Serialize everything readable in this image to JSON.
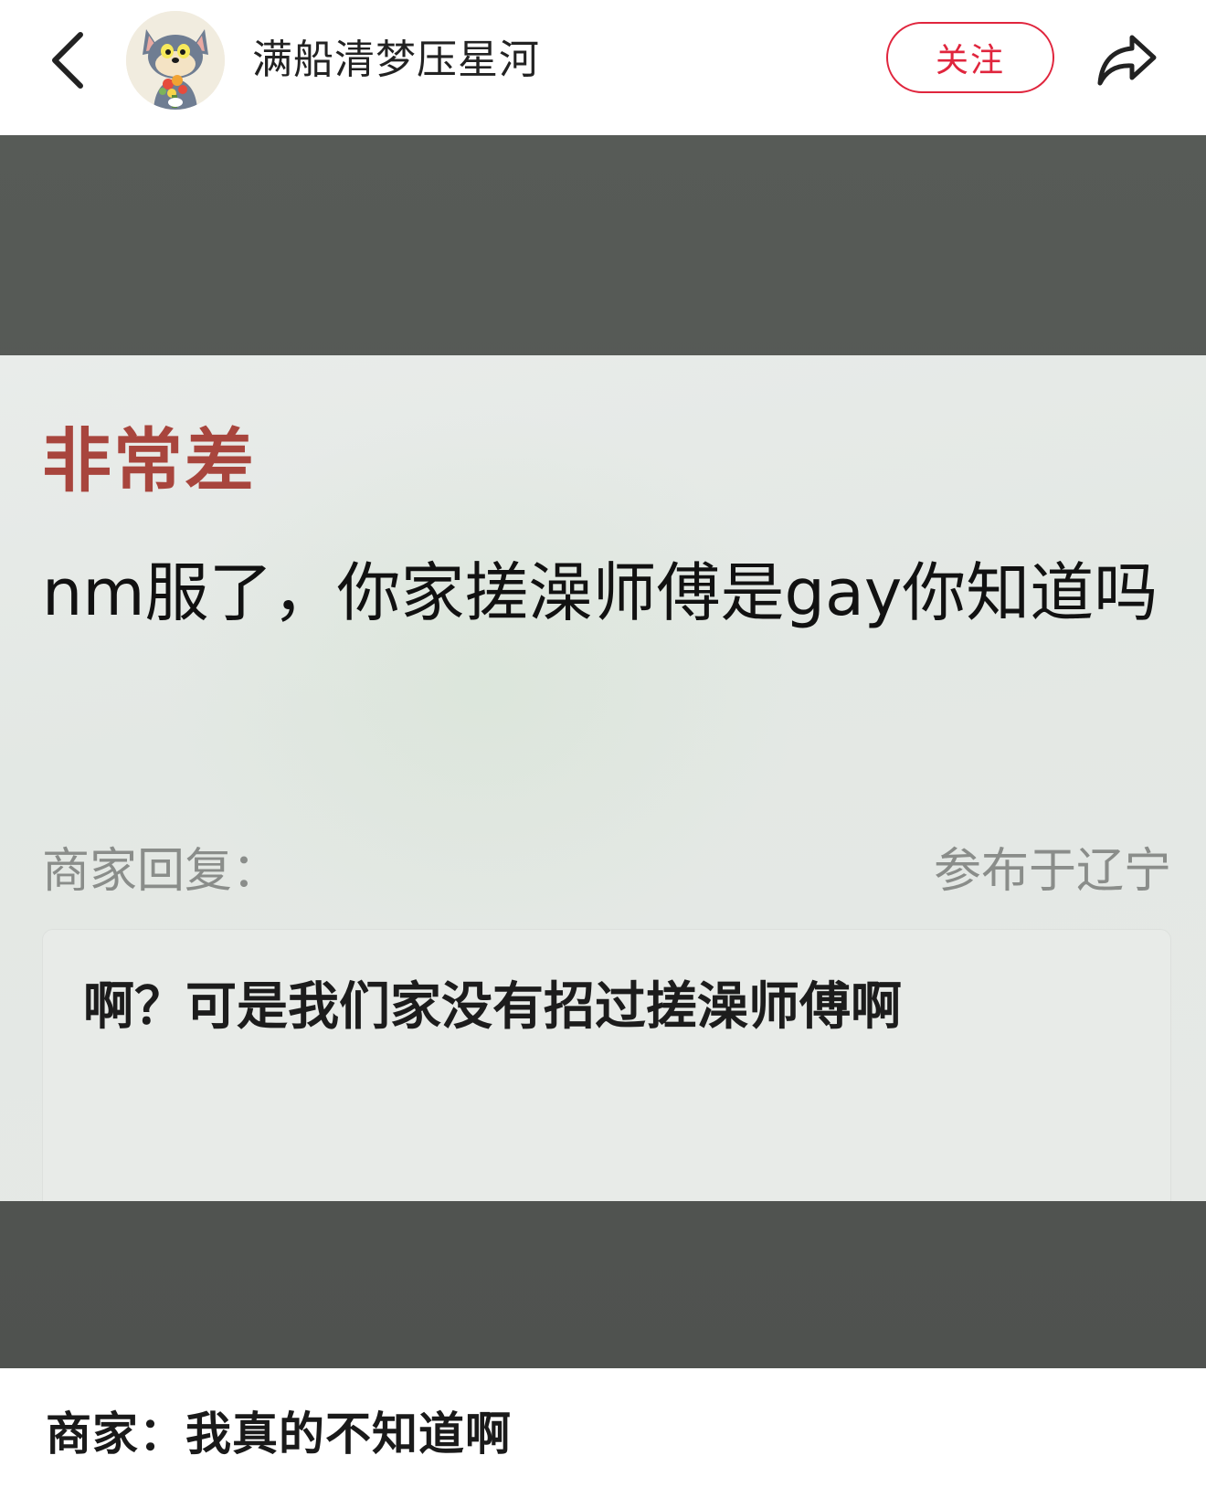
{
  "header": {
    "back_icon": "chevron-left-icon",
    "avatar_icon": "cartoon-cat-avatar",
    "username": "满船清梦压星河",
    "follow_label": "关注",
    "share_icon": "share-arrow-icon"
  },
  "media": {
    "rating": "非常差",
    "review_text": "nm服了，你家搓澡师傅是gay你知道吗",
    "reply_label": "商家回复：",
    "location": "参布于辽宁",
    "reply_text": "啊？可是我们家没有招过搓澡师傅啊"
  },
  "caption": "商家：我真的不知道啊",
  "colors": {
    "accent": "#e0253d",
    "rating_red": "#a8453d",
    "backdrop": "#55595a"
  }
}
